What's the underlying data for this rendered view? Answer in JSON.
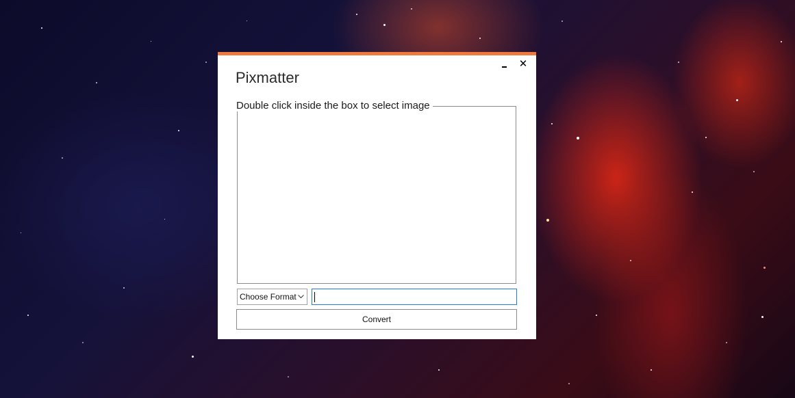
{
  "window": {
    "title": "Pixmatter",
    "accent_color": "#ee7a3f",
    "minimize_icon": "minimize-icon",
    "close_icon": "close-icon",
    "close_glyph": "✕"
  },
  "image_box": {
    "label": "Double click inside the box to select image"
  },
  "format_select": {
    "selected": "Choose Format",
    "icon": "chevron-down-icon"
  },
  "name_input": {
    "value": "",
    "border_color": "#1e7bd8"
  },
  "convert_button": {
    "label": "Convert"
  }
}
